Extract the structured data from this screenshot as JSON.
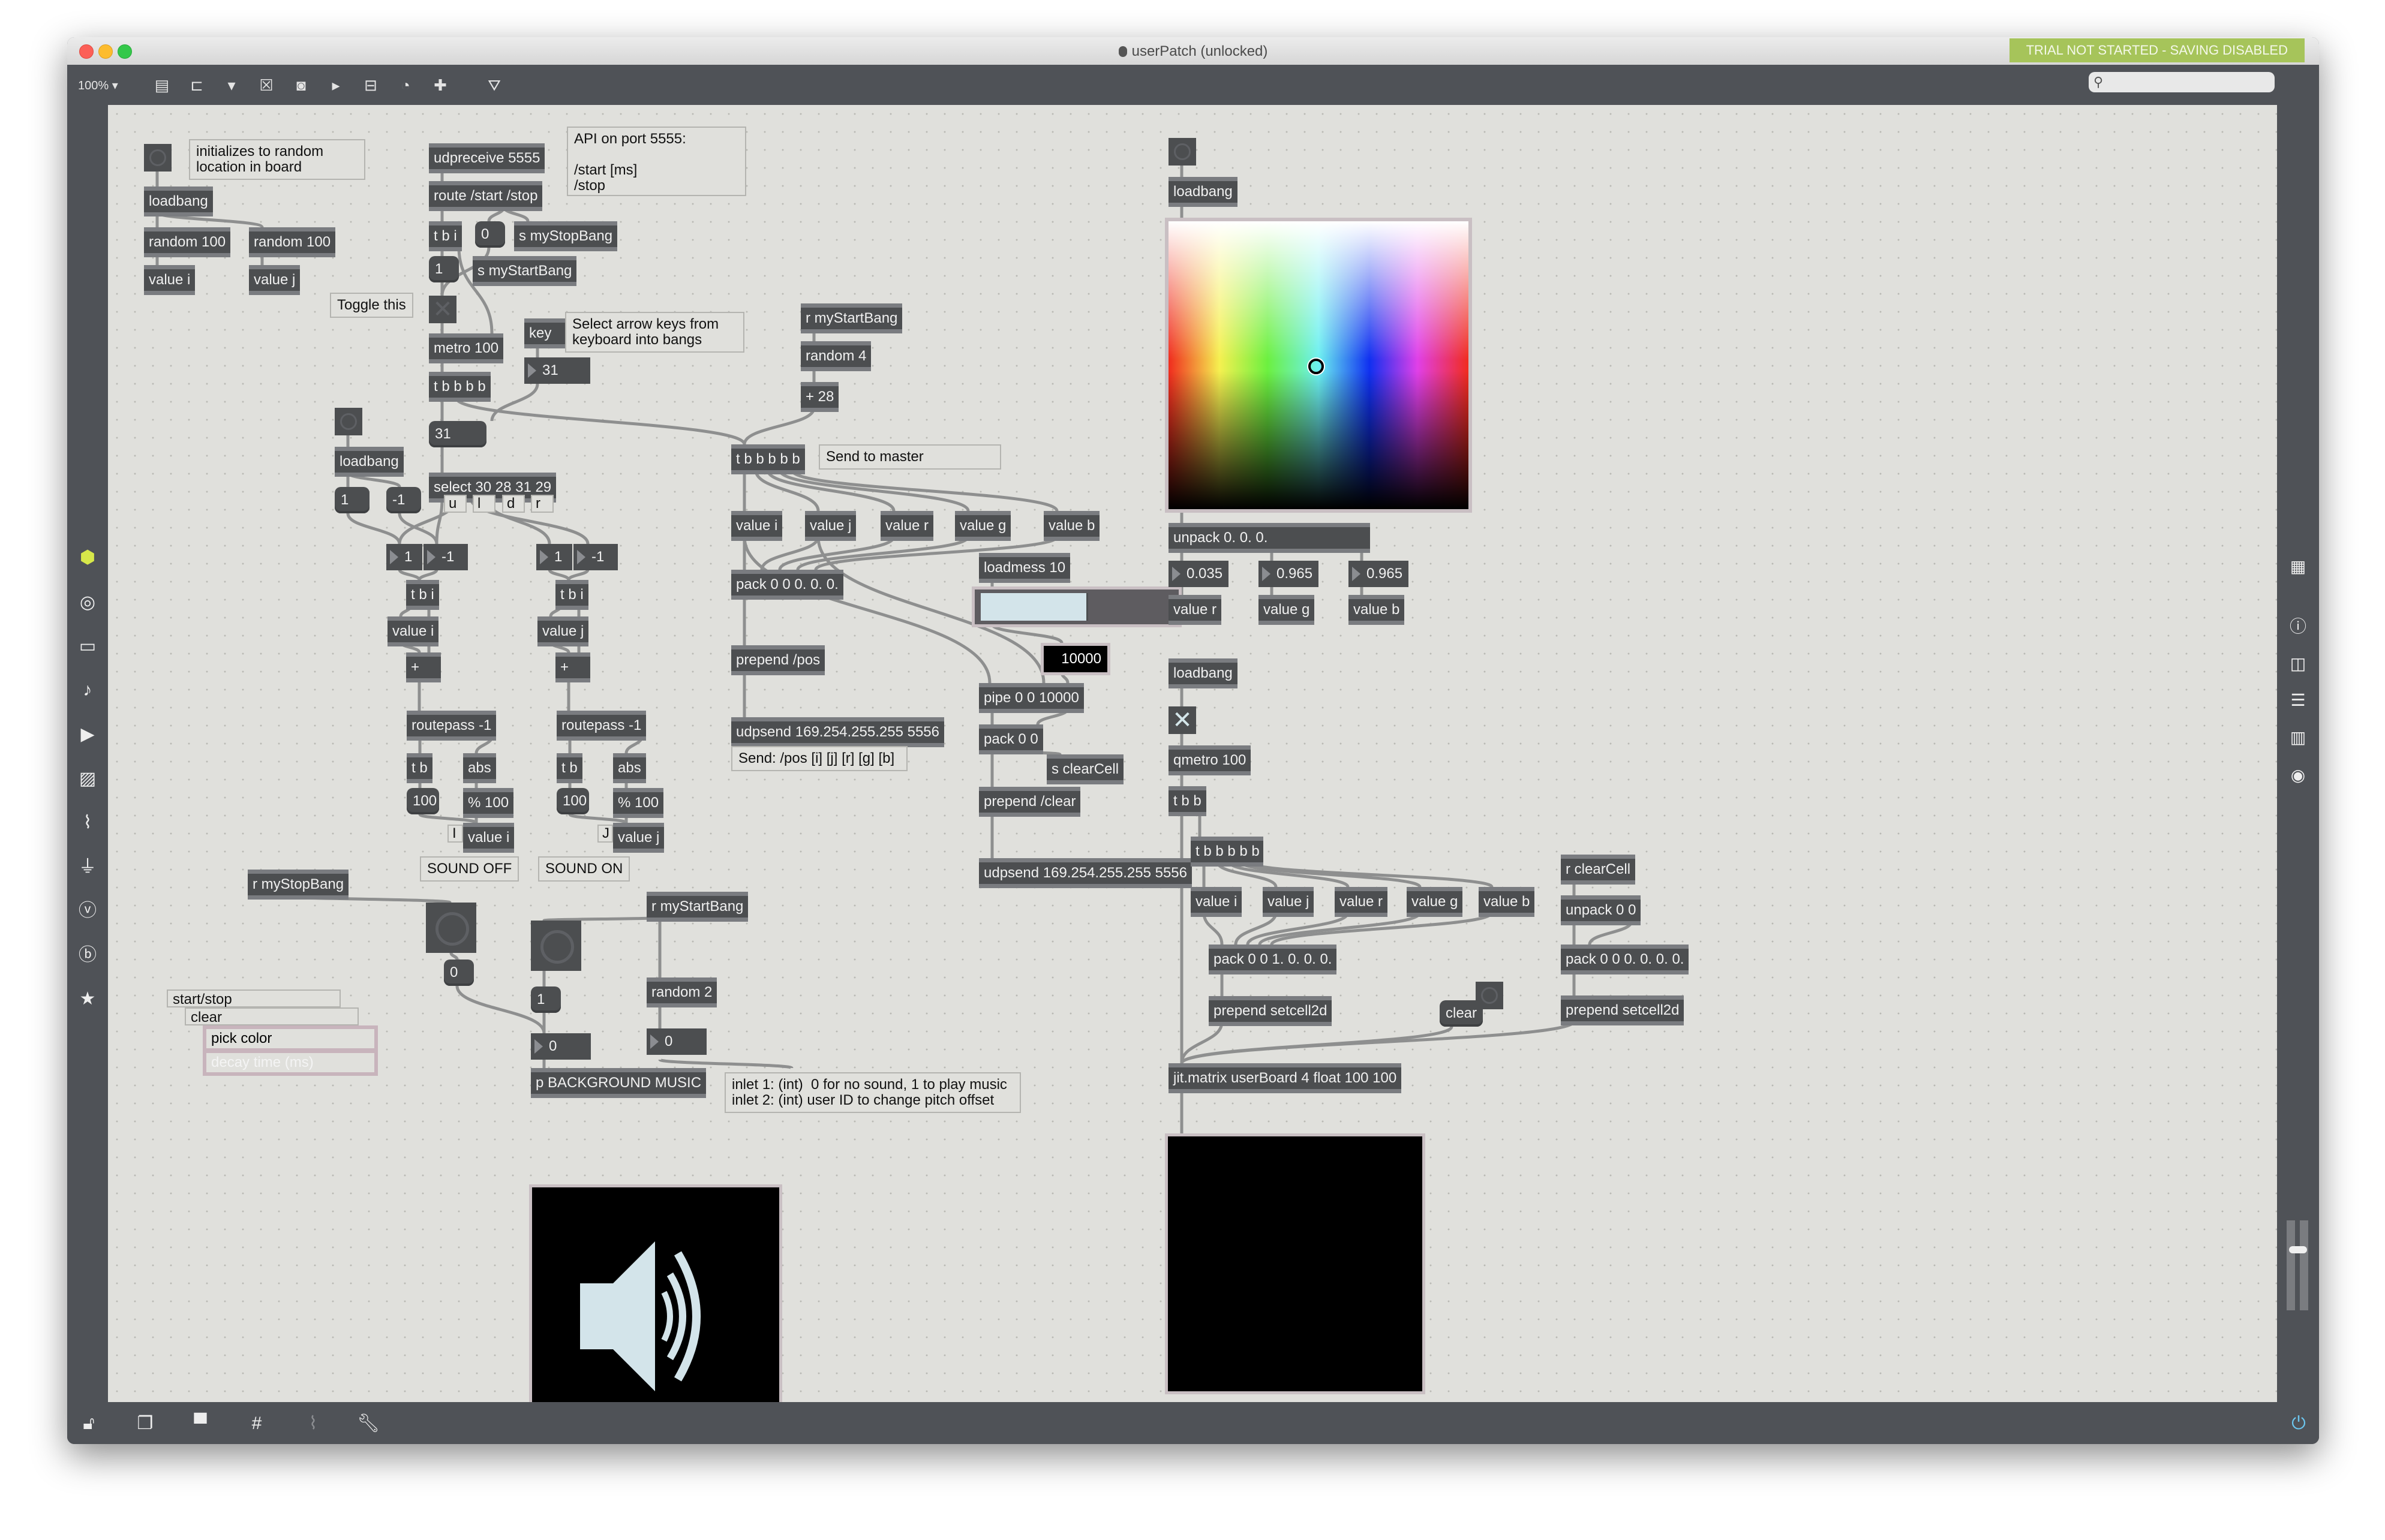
{
  "window": {
    "title": "userPatch (unlocked)",
    "trial_banner": "TRIAL NOT STARTED - SAVING DISABLED",
    "trial_color": "#a6c45a"
  },
  "toolbar": {
    "zoom": "100% ▾",
    "icons": [
      "new-object-icon",
      "message-icon",
      "comment-icon",
      "toggle-icon",
      "button-icon",
      "number-icon",
      "slider-icon",
      "dial-icon",
      "add-icon",
      "paint-bucket-icon"
    ],
    "search_placeholder": ""
  },
  "left_sidebar": {
    "icons": [
      "package-cube-icon",
      "circle-target-icon",
      "device-icon",
      "music-note-icon",
      "video-icon",
      "image-icon",
      "paperclip-icon",
      "plug-icon",
      "v-badge-icon",
      "b-badge-icon",
      "star-icon"
    ],
    "active_color": "#d7e84a"
  },
  "right_sidebar": {
    "icons": [
      "meter-grid-icon",
      "info-icon",
      "split-view-icon",
      "list-icon",
      "book-icon",
      "camera-icon"
    ],
    "power_color": "#6cc7f0"
  },
  "bottom_bar": {
    "icons": [
      "unlock-icon",
      "windows-icon",
      "presentation-icon",
      "grid-icon",
      "attach-add-icon",
      "wrench-icon"
    ]
  },
  "patch": {
    "comments": {
      "init_random": "initializes to random\nlocation in board",
      "api": "API on port 5555:\n\n/start [ms]\n/stop",
      "toggle_this": "Toggle this",
      "arrow_keys": "Select arrow keys from\nkeyboard into bangs",
      "send_master": "Send to master",
      "send_format": "Send: /pos [i] [j] [r] [g] [b]",
      "sound_off": "SOUND OFF",
      "sound_on": "SOUND ON",
      "label_i": "I",
      "label_j": "J",
      "dir_u": "u",
      "dir_l": "l",
      "dir_d": "d",
      "dir_r": "r",
      "inlets": "inlet 1: (int)  0 for no sound, 1 to play music\ninlet 2: (int) user ID to change pitch offset",
      "start_stop": "start/stop",
      "clear": "clear"
    },
    "attrui": {
      "pick_color": "pick color",
      "decay_time": "decay time (ms)"
    },
    "objects": {
      "loadbang1": "loadbang",
      "random100a": "random 100",
      "random100b": "random 100",
      "value_i1": "value i",
      "value_j1": "value j",
      "udpreceive": "udpreceive 5555",
      "route": "route /start /stop",
      "tbi_top": "t b i",
      "s_stop": "s myStopBang",
      "s_start": "s myStartBang",
      "metro": "metro 100",
      "key": "key",
      "tbbbb": "t b b b b",
      "loadbang2": "loadbang",
      "select": "select 30 28 31 29",
      "tbi_l": "t b i",
      "tbi_r": "t b i",
      "value_i2": "value i",
      "value_j2": "value j",
      "plus_l": "+",
      "plus_r": "+",
      "routepass_l": "routepass -1",
      "routepass_r": "routepass -1",
      "tb_l": "t b",
      "tb_r": "t b",
      "abs_l": "abs",
      "abs_r": "abs",
      "mod_l": "% 100",
      "mod_r": "% 100",
      "value_i3": "value i",
      "value_j3": "value j",
      "r_start1": "r myStartBang",
      "random4": "random 4",
      "plus28": "+ 28",
      "tbbbbb1": "t b b b b b",
      "value_i4": "value i",
      "value_j4": "value j",
      "value_r4": "value r",
      "value_g4": "value g",
      "value_b4": "value b",
      "pack1": "pack 0 0 0. 0. 0.",
      "loadmess": "loadmess 10",
      "prepend_pos": "prepend /pos",
      "udpsend1": "udpsend 169.254.255.255 5556",
      "pipe": "pipe 0 0 10000",
      "pack00": "pack 0 0",
      "s_clear": "s clearCell",
      "prepend_clear": "prepend /clear",
      "udpsend2": "udpsend 169.254.255.255 5556",
      "r_stop": "r myStopBang",
      "r_start2": "r myStartBang",
      "random2": "random 2",
      "p_bg": "p BACKGROUND MUSIC",
      "loadbang3": "loadbang",
      "unpack": "unpack 0. 0. 0.",
      "value_r5": "value r",
      "value_g5": "value g",
      "value_b5": "value b",
      "loadbang4": "loadbang",
      "qmetro": "qmetro 100",
      "tbb": "t b b",
      "tbbbbb2": "t b b b b b",
      "value_i6": "value i",
      "value_j6": "value j",
      "value_r6": "value r",
      "value_g6": "value g",
      "value_b6": "value b",
      "pack2": "pack 0 0 1. 0. 0. 0.",
      "prepend_set1": "prepend setcell2d",
      "r_clear": "r clearCell",
      "unpack00": "unpack 0 0",
      "pack3": "pack 0 0 0. 0. 0. 0.",
      "prepend_set2": "prepend setcell2d",
      "jitmatrix": "jit.matrix userBoard 4 float 100 100"
    },
    "messages": {
      "msg0_top": "0",
      "msg1_top": "1",
      "msg31": "31",
      "msg1_lb": "1",
      "msgm1_lb": "-1",
      "msg100_l": "100",
      "msg100_r": "100",
      "msg0_stop": "0",
      "msg1_start": "1",
      "clear": "clear"
    },
    "numbers": {
      "key_num": "31",
      "n1_l": "1",
      "nm1_l": "-1",
      "n1_r": "1",
      "nm1_r": "-1",
      "sound_num": "0",
      "rand_num": "0",
      "decay": "10000",
      "r_val": "0.035",
      "g_val": "0.965",
      "b_val": "0.965"
    },
    "slider_value": 0.55,
    "toggles": {
      "metro_toggle": false,
      "qmetro_toggle": true
    },
    "colorpicker_selected": {
      "r": 0.035,
      "g": 0.965,
      "b": 0.965
    }
  }
}
